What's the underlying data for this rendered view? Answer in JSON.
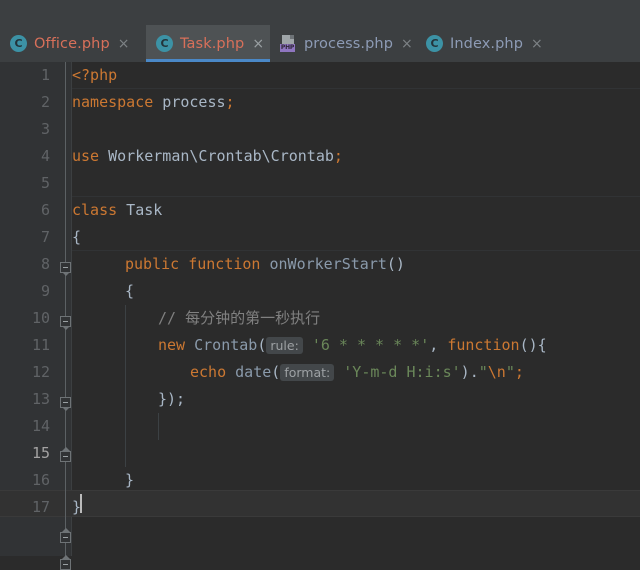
{
  "window": {
    "app": "PhpStorm",
    "theme": "Darcula"
  },
  "colors": {
    "editor_bg": "#2b2b2b",
    "gutter_bg": "#313335",
    "chrome_bg": "#3c3f41",
    "active_tab_bg": "#4e5254",
    "active_tab_underline": "#4a88c7",
    "keyword": "#cc7832",
    "string": "#6a8759",
    "comment": "#808080",
    "identifier": "#a9b7c6",
    "method": "#8a9aab",
    "line_number": "#606366",
    "current_line_number": "#a4a3a3",
    "tab_label_modified": "#d8705a",
    "tab_label_normal": "#8d9bb5",
    "class_icon": "#3c92a5",
    "php_badge": "#8f76c0"
  },
  "tabs": [
    {
      "label": "Office.php",
      "icon": "php-class-icon",
      "active": false,
      "label_color": "red",
      "close_label": "×"
    },
    {
      "label": "Task.php",
      "icon": "php-class-icon",
      "active": true,
      "label_color": "red",
      "close_label": "×"
    },
    {
      "label": "process.php",
      "icon": "php-file-icon",
      "active": false,
      "label_color": "blue",
      "close_label": "×"
    },
    {
      "label": "Index.php",
      "icon": "php-class-icon",
      "active": false,
      "label_color": "blue",
      "close_label": "×"
    }
  ],
  "icons": {
    "class_letter": "C",
    "php_badge_text": "PHP"
  },
  "editor": {
    "current_line": 15,
    "line_numbers": [
      "1",
      "2",
      "3",
      "4",
      "5",
      "6",
      "7",
      "8",
      "9",
      "10",
      "11",
      "12",
      "13",
      "14",
      "15",
      "16",
      "17"
    ],
    "lines": [
      {
        "n": "1",
        "text": "<?php"
      },
      {
        "n": "2",
        "text": "namespace process;"
      },
      {
        "n": "3",
        "text": ""
      },
      {
        "n": "4",
        "text": "use Workerman\\Crontab\\Crontab;"
      },
      {
        "n": "5",
        "text": ""
      },
      {
        "n": "6",
        "text": "class Task"
      },
      {
        "n": "7",
        "text": "{"
      },
      {
        "n": "8",
        "text": "    public function onWorkerStart()"
      },
      {
        "n": "9",
        "text": "    {"
      },
      {
        "n": "10",
        "text": "        // 每分钟的第一秒执行"
      },
      {
        "n": "11",
        "text": "        new Crontab( rule: '6 * * * * *', function(){"
      },
      {
        "n": "12",
        "text": "            echo date( format: 'Y-m-d H:i:s').\"\\n\";"
      },
      {
        "n": "13",
        "text": "        });"
      },
      {
        "n": "14",
        "text": ""
      },
      {
        "n": "15",
        "text": ""
      },
      {
        "n": "16",
        "text": "    }"
      },
      {
        "n": "17",
        "text": "}"
      }
    ],
    "tokens": {
      "l1_php": "<?php",
      "l2_kw": "namespace",
      "l2_name": " process",
      "l2_semi": ";",
      "l4_kw": "use",
      "l4_name": " Workerman\\Crontab\\Crontab",
      "l4_semi": ";",
      "l6_kw": "class",
      "l6_name": " Task",
      "l7_brace": "{",
      "l8_kw1": "public",
      "l8_kw2": " function",
      "l8_name": " onWorkerStart",
      "l8_parens": "()",
      "l9_brace": "{",
      "l10_comment": "// 每分钟的第一秒执行",
      "l11_kw": "new",
      "l11_cls": " Crontab",
      "l11_open": "(",
      "l11_hint": "rule:",
      "l11_str": " '6 * * * * *'",
      "l11_comma": ", ",
      "l11_fnkw": "function",
      "l11_tail": "(){",
      "l12_kw": "echo",
      "l12_fn": " date",
      "l12_open": "(",
      "l12_hint": "format:",
      "l12_str": " 'Y-m-d H:i:s'",
      "l12_mid": ").",
      "l12_str2": "\"",
      "l12_esc": "\\n",
      "l12_str3": "\"",
      "l12_semi": ";",
      "l13_close": "});",
      "l16_brace": "}",
      "l17_brace": "}"
    }
  }
}
